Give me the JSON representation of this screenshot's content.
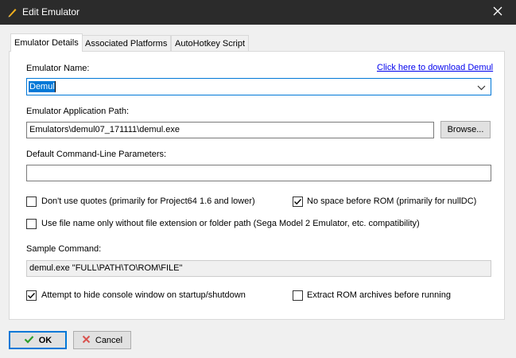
{
  "window": {
    "title": "Edit Emulator"
  },
  "tabs": [
    {
      "label": "Emulator Details",
      "active": true
    },
    {
      "label": "Associated Platforms",
      "active": false
    },
    {
      "label": "AutoHotkey Script",
      "active": false
    }
  ],
  "details": {
    "emulator_name_label": "Emulator Name:",
    "download_link": "Click here to download Demul",
    "emulator_name_value": "Demul",
    "app_path_label": "Emulator Application Path:",
    "app_path_value": "Emulators\\demul07_171111\\demul.exe",
    "browse_label": "Browse...",
    "cmdline_label": "Default Command-Line Parameters:",
    "cmdline_value": "",
    "no_quotes": {
      "label": "Don't use quotes (primarily for Project64 1.6 and lower)",
      "checked": false
    },
    "no_space": {
      "label": "No space before ROM (primarily for nullDC)",
      "checked": true
    },
    "filename_only": {
      "label": "Use file name only without file extension or folder path (Sega Model 2 Emulator, etc. compatibility)",
      "checked": false
    },
    "sample_label": "Sample Command:",
    "sample_value": "demul.exe \"FULL\\PATH\\TO\\ROM\\FILE\"",
    "hide_console": {
      "label": "Attempt to hide console window on startup/shutdown",
      "checked": true
    },
    "extract_rom": {
      "label": "Extract ROM archives before running",
      "checked": false
    }
  },
  "footer": {
    "ok_label": "OK",
    "cancel_label": "Cancel"
  },
  "colors": {
    "accent": "#0078d7",
    "ok_check": "#2e9e2e",
    "cancel_x": "#d9534f",
    "titlebar": "#2b2b2b"
  }
}
